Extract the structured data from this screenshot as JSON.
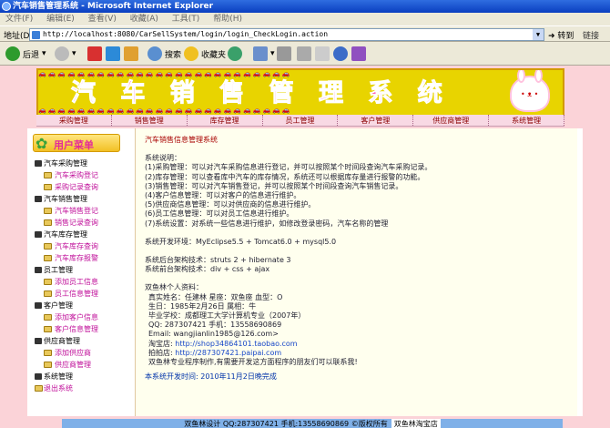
{
  "window": {
    "title": "汽车销售管理系统 - Microsoft Internet Explorer"
  },
  "menubar": [
    "文件(F)",
    "编辑(E)",
    "查看(V)",
    "收藏(A)",
    "工具(T)",
    "帮助(H)"
  ],
  "address": {
    "label": "地址(D)",
    "url": "http://localhost:8080/CarSellSystem/login/login_CheckLogin.action",
    "go": "转到",
    "links": "链接"
  },
  "toolbar": {
    "back": "后退",
    "search": "搜索",
    "favorites": "收藏夹"
  },
  "banner": {
    "title": "汽 车 销 售 管 理 系 统"
  },
  "nav": [
    "采购管理",
    "销售管理",
    "库存管理",
    "员工管理",
    "客户管理",
    "供应商管理",
    "系统管理"
  ],
  "sidebar": {
    "title": "用户菜单",
    "groups": [
      {
        "label": "汽车采购管理",
        "items": [
          "汽车采购登记",
          "采购记录查询"
        ]
      },
      {
        "label": "汽车销售管理",
        "items": [
          "汽车销售登记",
          "销售记录查询"
        ]
      },
      {
        "label": "汽车库存管理",
        "items": [
          "汽车库存查询",
          "汽车库存报警"
        ]
      },
      {
        "label": "员工管理",
        "items": [
          "添加员工信息",
          "员工信息管理"
        ]
      },
      {
        "label": "客户管理",
        "items": [
          "添加客户信息",
          "客户信息管理"
        ]
      },
      {
        "label": "供应商管理",
        "items": [
          "添加供应商",
          "供应商管理"
        ]
      }
    ],
    "system": "系统管理",
    "logout": "退出系统"
  },
  "main": {
    "title": "汽车销售信息管理系统",
    "desc_title": "系统说明：",
    "desc": [
      "(1)采购管理：可以对汽车采购信息进行登记，并可以按照某个时间段查询汽车采购记录。",
      "(2)库存管理：可以查看库中汽车的库存情况，系统还可以根据库存量进行报警的功能。",
      "(3)销售管理：可以对汽车销售登记，并可以按照某个时间段查询汽车销售记录。",
      "(4)客户信息管理：可以对客户的信息进行维护。",
      "(5)供应商信息管理：可以对供应商的信息进行维护。",
      "(6)员工信息管理：可以对员工信息进行维护。",
      "(7)系统设置：对系统一些信息进行维护，如修改登录密码，汽车名称的管理"
    ],
    "env": "系统开发环境：MyEclipse5.5 + Tomcat6.0 + mysql5.0",
    "arch_back": "系统后台架构技术：struts 2 + hibernate 3",
    "arch_front": "系统前台架构技术：div + css + ajax",
    "profile_title": "双鱼林个人资料：",
    "profile": [
      "真实姓名：任建林  星座：双鱼座  血型：O",
      "生日：1985年2月26日 属相：牛",
      "毕业学校：成都理工大学计算机专业（2007年）",
      "QQ: 287307421 手机：13558690869",
      "Email: wangjianlin1985@126.com>"
    ],
    "shop_label": "淘宝店: ",
    "shop_url": "http://shop34864101.taobao.com",
    "paipai_label": "拍拍店: ",
    "paipai_url": "http://287307421.paipai.com",
    "note": "双鱼林专业程序制作,有需要开发这方面程序的朋友们可以联系我!",
    "completed": "本系统开发时间: 2010年11月2日晚完成"
  },
  "footer": {
    "text": "双鱼林设计  QQ:287307421 手机:13558690869 ©版权所有",
    "shop": "双鱼林淘宝店"
  }
}
